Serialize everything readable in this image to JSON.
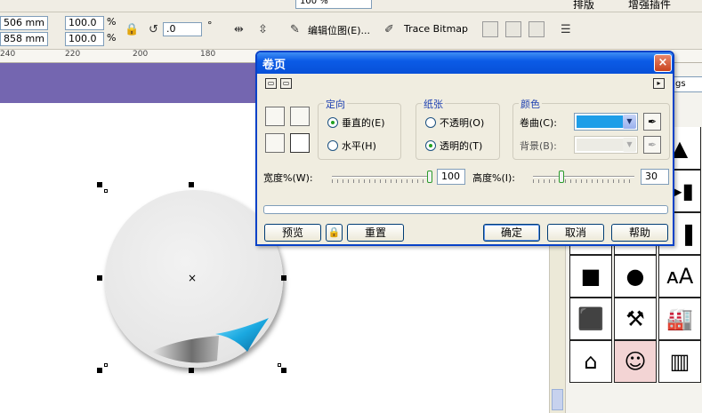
{
  "menubar": {
    "zoom_value": "100 %",
    "layout_label": "排版",
    "plugins_label": "增强插件"
  },
  "propbar": {
    "width_mm": "506 mm",
    "height_mm": "858 mm",
    "scale_x": "100.0",
    "scale_y": "100.0",
    "percent_symbol": "%",
    "rotation": ".0",
    "degree_symbol": "°",
    "edit_bitmap_label": "编辑位图(E)...",
    "trace_bitmap_label": "Trace Bitmap"
  },
  "ruler": {
    "labels": [
      "240",
      "220",
      "200",
      "180"
    ]
  },
  "docker": {
    "input_value": "gs"
  },
  "dialog": {
    "title": "卷页",
    "close_glyph": "×",
    "orientation": {
      "title": "定向",
      "vertical": "垂直的(E)",
      "horizontal": "水平(H)",
      "selected": "vertical"
    },
    "paper": {
      "title": "纸张",
      "opaque": "不透明(O)",
      "transparent": "透明的(T)",
      "selected": "transparent"
    },
    "color": {
      "title": "颜色",
      "curl_label": "卷曲(C):",
      "background_label": "背景(B):",
      "curl_color": "#1e9ee8",
      "background_color": "#ecebe4"
    },
    "width_label": "宽度%(W):",
    "width_value": "100",
    "height_label": "高度%(I):",
    "height_value": "30",
    "buttons": {
      "preview": "预览",
      "reset": "重置",
      "ok": "确定",
      "cancel": "取消",
      "help": "帮助"
    }
  }
}
